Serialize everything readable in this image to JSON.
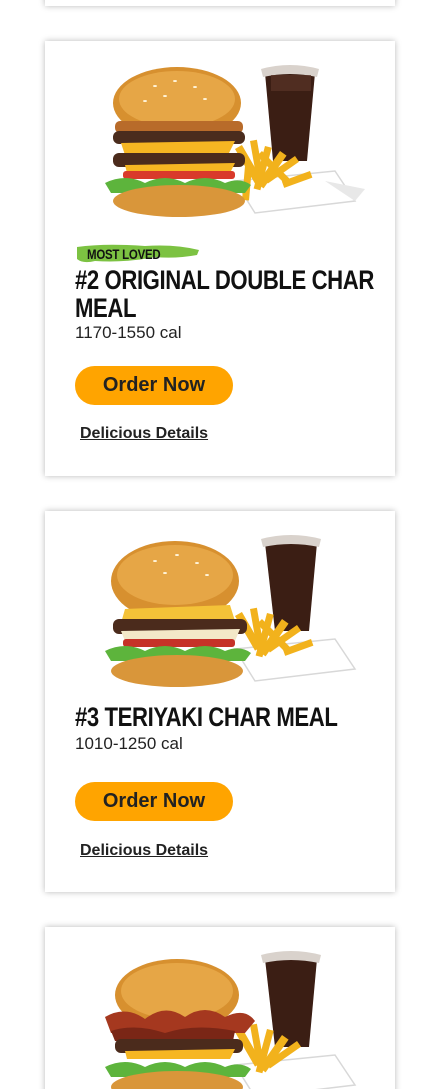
{
  "colors": {
    "button": "#ffa400",
    "badge_green": "#7cc242",
    "text": "#111111"
  },
  "meals": [
    {
      "badge": "MOST LOVED",
      "title": "#2 Original Double Char Meal",
      "calories": "1170-1550 cal",
      "order_label": "Order Now",
      "details_label": "Delicious Details",
      "image_icon": "double-char-burger-fries-soda"
    },
    {
      "title": "#3 Teriyaki Char Meal",
      "calories": "1010-1250 cal",
      "order_label": "Order Now",
      "details_label": "Delicious Details",
      "image_icon": "teriyaki-burger-fries-soda"
    },
    {
      "image_icon": "bacon-burger-fries-soda"
    }
  ]
}
